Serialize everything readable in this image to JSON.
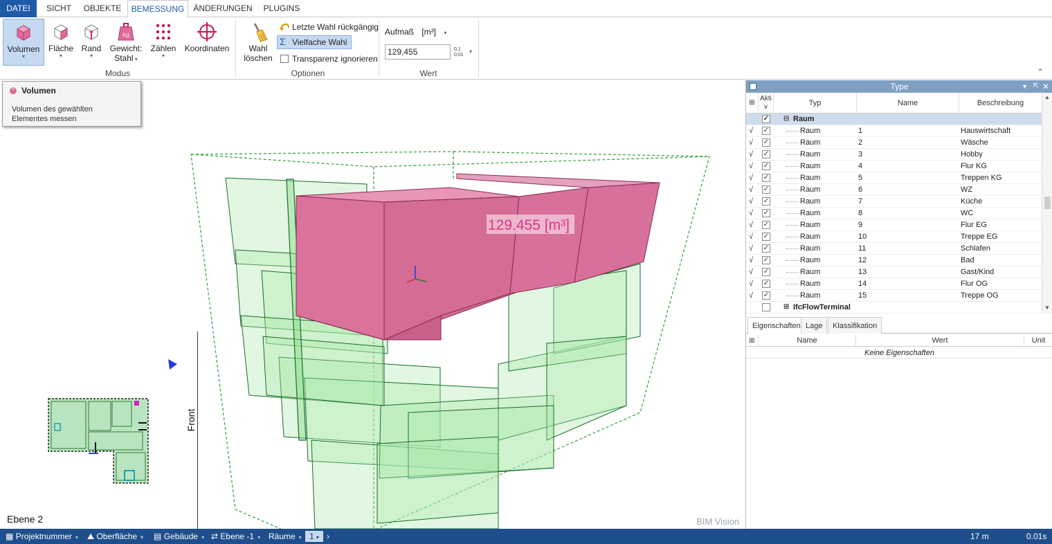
{
  "tabs": [
    "DATEI",
    "SICHT",
    "OBJEKTE",
    "BEMESSUNG",
    "ÄNDERUNGEN",
    "PLUGINS"
  ],
  "ribbon": {
    "modus_buttons": [
      {
        "label": "Volumen",
        "icon": "volume-cube-icon"
      },
      {
        "label": "Fläche",
        "icon": "area-cube-icon"
      },
      {
        "label": "Rand",
        "icon": "edge-cube-icon"
      },
      {
        "label": "Gewicht:",
        "label2": "Stahl",
        "icon": "weight-icon"
      },
      {
        "label": "Zählen",
        "icon": "count-dots-icon"
      },
      {
        "label": "Koordinaten",
        "icon": "crosshair-icon"
      }
    ],
    "modus_label": "Modus",
    "wahl_loeschen": {
      "line1": "Wahl",
      "line2": "löschen"
    },
    "optionen": {
      "undo": "Letzte Wahl rückgängig",
      "multi": "Vielfache Wahl",
      "transparency": "Transparenz ignorieren"
    },
    "optionen_label": "Optionen",
    "wert": {
      "aufmass_label": "Aufmaß",
      "unit": "[m³]",
      "value": "129,455",
      "precision_top": "0,1",
      "precision_bottom": "0,01"
    },
    "wert_label": "Wert"
  },
  "tooltip": {
    "title": "Volumen",
    "line1": "Volumen des gewählten",
    "line2": "Elementes messen"
  },
  "viewport": {
    "measurement": "129.455 [m³]",
    "watermark": "BIM Vision",
    "level_label": "Ebene 2",
    "front_label": "Front",
    "colors": {
      "selected": "#d76f96",
      "elements": "#b7ecb7",
      "edges": "#2e7d32"
    }
  },
  "panel": {
    "title": "Type",
    "columns": [
      "Akti v",
      "Typ",
      "Name",
      "Beschreibung"
    ],
    "group_name": "Raum",
    "rows": [
      {
        "typ": "Raum",
        "name": "1",
        "desc": "Hauswirtschaft"
      },
      {
        "typ": "Raum",
        "name": "2",
        "desc": "Wäsche"
      },
      {
        "typ": "Raum",
        "name": "3",
        "desc": "Hobby"
      },
      {
        "typ": "Raum",
        "name": "4",
        "desc": "Flur KG"
      },
      {
        "typ": "Raum",
        "name": "5",
        "desc": "Treppen KG"
      },
      {
        "typ": "Raum",
        "name": "6",
        "desc": "WZ"
      },
      {
        "typ": "Raum",
        "name": "7",
        "desc": "Küche"
      },
      {
        "typ": "Raum",
        "name": "8",
        "desc": "WC"
      },
      {
        "typ": "Raum",
        "name": "9",
        "desc": "Flur EG"
      },
      {
        "typ": "Raum",
        "name": "10",
        "desc": "Treppe EG"
      },
      {
        "typ": "Raum",
        "name": "11",
        "desc": "Schlafen"
      },
      {
        "typ": "Raum",
        "name": "12",
        "desc": "Bad"
      },
      {
        "typ": "Raum",
        "name": "13",
        "desc": "Gast/Kind"
      },
      {
        "typ": "Raum",
        "name": "14",
        "desc": "Flur OG"
      },
      {
        "typ": "Raum",
        "name": "15",
        "desc": "Treppe OG"
      }
    ],
    "next_group": "IfcFlowTerminal",
    "prop_tabs": [
      "Eigenschaften",
      "Lage",
      "Klassifikation"
    ],
    "prop_columns": [
      "Name",
      "Wert",
      "Unit"
    ],
    "prop_empty": "Keine Eigenschaften"
  },
  "statusbar": {
    "projekt": "Projektnummer",
    "oberflaeche": "Oberfläche",
    "gebaeude": "Gebäude",
    "ebene": "Ebene -1",
    "raeume": "Räume",
    "raum_nr": "1",
    "distance": "17 m",
    "time": "0.01s"
  }
}
